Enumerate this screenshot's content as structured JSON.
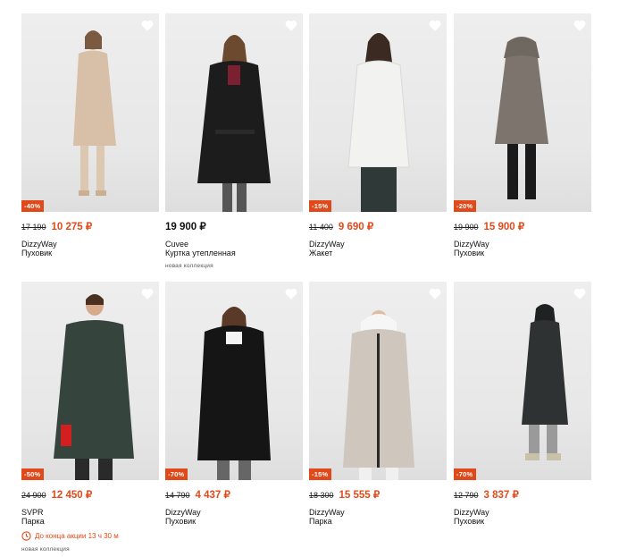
{
  "colors": {
    "accent": "#e04a1a",
    "text": "#111111",
    "photo_bg": "#eeeeee"
  },
  "currency": "₽",
  "products": [
    {
      "discount": "-40%",
      "old_price": "17 190",
      "price": "10 275 ₽",
      "brand": "DizzyWay",
      "name": "Пуховик",
      "coat_color": "#d8c0a8"
    },
    {
      "discount": "",
      "old_price": "",
      "price": "19 900 ₽",
      "brand": "Cuvee",
      "name": "Куртка утепленная",
      "tag": "новая коллекция",
      "coat_color": "#1c1c1c"
    },
    {
      "discount": "-15%",
      "old_price": "11 400",
      "price": "9 690 ₽",
      "brand": "DizzyWay",
      "name": "Жакет",
      "coat_color": "#f2f2f0"
    },
    {
      "discount": "-20%",
      "old_price": "19 900",
      "price": "15 900 ₽",
      "brand": "DizzyWay",
      "name": "Пуховик",
      "coat_color": "#7c746d"
    },
    {
      "discount": "-50%",
      "old_price": "24 900",
      "price": "12 450 ₽",
      "brand": "SVPR",
      "name": "Парка",
      "timer": "До конца акции 13 ч 30 м",
      "tag": "новая коллекция",
      "coat_color": "#35443c"
    },
    {
      "discount": "-70%",
      "old_price": "14 790",
      "price": "4 437 ₽",
      "brand": "DizzyWay",
      "name": "Пуховик",
      "coat_color": "#151515"
    },
    {
      "discount": "-15%",
      "old_price": "18 300",
      "price": "15 555 ₽",
      "brand": "DizzyWay",
      "name": "Парка",
      "coat_color": "#cfc6bd"
    },
    {
      "discount": "-70%",
      "old_price": "12 790",
      "price": "3 837 ₽",
      "brand": "DizzyWay",
      "name": "Пуховик",
      "coat_color": "#2e3233"
    }
  ]
}
